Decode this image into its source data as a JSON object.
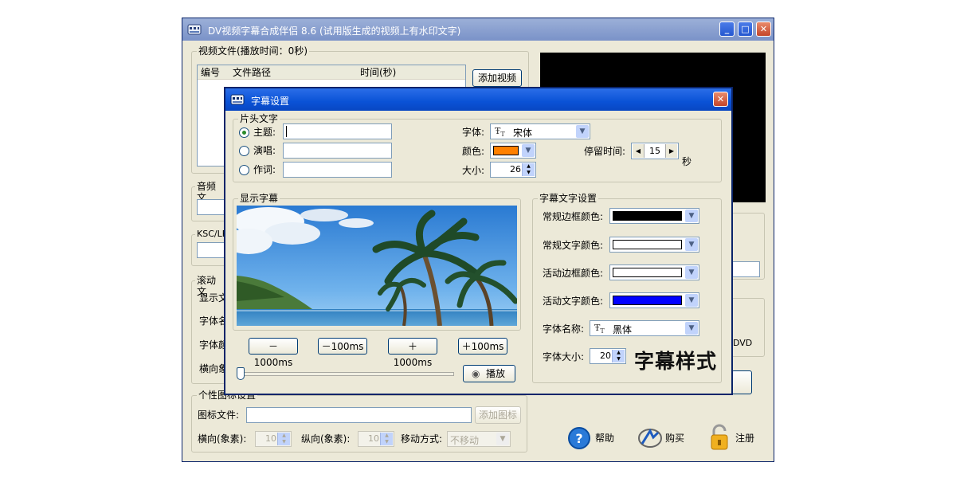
{
  "main": {
    "title": "DV视频字幕合成伴侣 8.6 (试用版生成的视频上有水印文字)",
    "video_group": "视频文件(播放时间：0秒)",
    "video_cols": [
      "编号",
      "文件路径",
      "时间(秒)"
    ],
    "add_video": "添加视频",
    "audio_group": "音频文",
    "ksc_group": "KSC/LR",
    "scroll_group": "滚动文",
    "scroll_labels": [
      "显示文",
      "字体名",
      "字体颜",
      "横向象"
    ],
    "icon_group": "个性图标设置",
    "icon_file_label": "图标文件:",
    "add_icon": "添加图标",
    "h_label": "横向(象素):",
    "h_value": "10",
    "v_label": "纵向(象素):",
    "v_value": "10",
    "move_label": "移动方式:",
    "move_value": "不移动",
    "dvd_fragment": "DVD",
    "help": "帮助",
    "buy": "购买",
    "register": "注册"
  },
  "dialog": {
    "title": "字幕设置",
    "head_group": "片头文字",
    "radio_labels": [
      "主题:",
      "演唱:",
      "作词:"
    ],
    "font_label": "字体:",
    "font_value": "宋体",
    "color_label": "颜色:",
    "color_value": "#ff8000",
    "size_label": "大小:",
    "size_value": "26",
    "stay_label": "停留时间:",
    "stay_value": "15",
    "stay_unit": "秒",
    "display_group": "显示字幕",
    "seek_buttons": [
      "－1000ms",
      "－100ms",
      "＋1000ms",
      "＋100ms"
    ],
    "play": "播放",
    "style_group": "字幕文字设置",
    "normal_border_label": "常规边框颜色:",
    "normal_border_color": "#000000",
    "normal_text_label": "常规文字颜色:",
    "normal_text_color": "#ffffff",
    "active_border_label": "活动边框颜色:",
    "active_border_color": "#ffffff",
    "active_text_label": "活动文字颜色:",
    "active_text_color": "#0000ff",
    "font_name_label": "字体名称:",
    "font_name_value": "黑体",
    "font_size_label": "字体大小:",
    "font_size_value": "20",
    "sample_text": "字幕样式"
  }
}
